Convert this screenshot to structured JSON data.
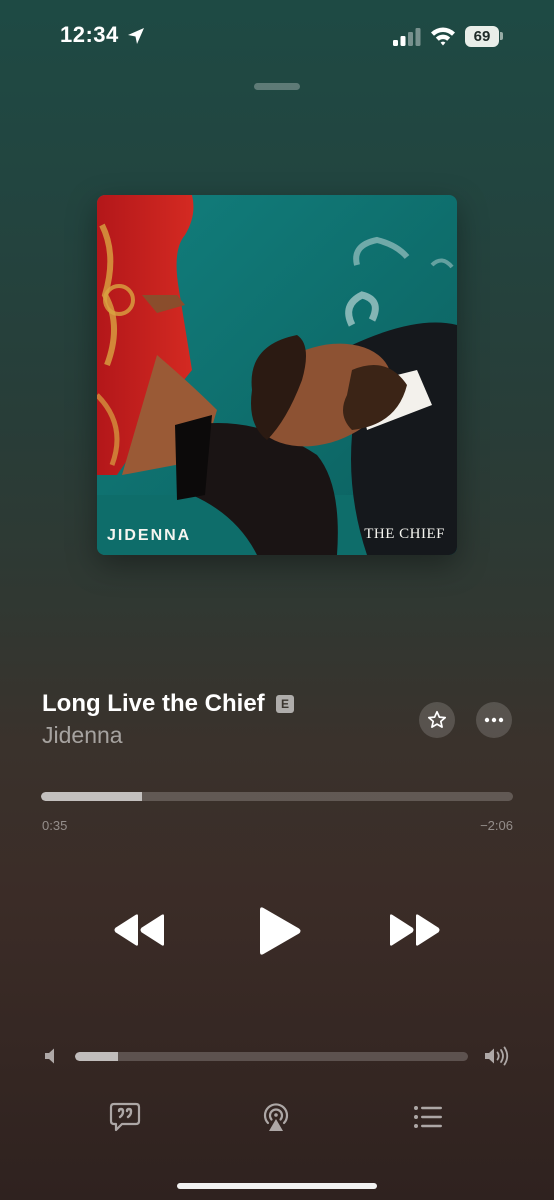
{
  "status_bar": {
    "time": "12:34",
    "battery_level": "69",
    "icons": [
      "location-arrow-icon",
      "cellular-signal-icon",
      "wifi-icon",
      "battery-icon"
    ]
  },
  "artwork": {
    "artist_text": "JIDENNA",
    "album_text": "THE CHIEF",
    "colors": {
      "teal": "#0f7a78",
      "red": "#c8201e",
      "gold": "#d9a441",
      "suit": "#15181c"
    }
  },
  "track": {
    "title": "Long Live the Chief",
    "explicit_badge": "E",
    "artist": "Jidenna"
  },
  "actions": {
    "favorite_icon": "star-icon",
    "more_icon": "ellipsis-icon"
  },
  "progress": {
    "elapsed": "0:35",
    "remaining": "−2:06",
    "fraction": 0.215
  },
  "controls": {
    "icons": [
      "rewind-icon",
      "play-icon",
      "fast-forward-icon"
    ]
  },
  "volume": {
    "fraction": 0.11,
    "icons": [
      "volume-low-icon",
      "volume-high-icon"
    ]
  },
  "bottom_bar": {
    "icons": [
      "lyrics-icon",
      "airplay-icon",
      "queue-icon"
    ]
  },
  "theme": {
    "gradient_top": "#1e4a44",
    "gradient_bottom": "#2f221f",
    "secondary_text": "rgba(255,255,255,0.55)"
  }
}
